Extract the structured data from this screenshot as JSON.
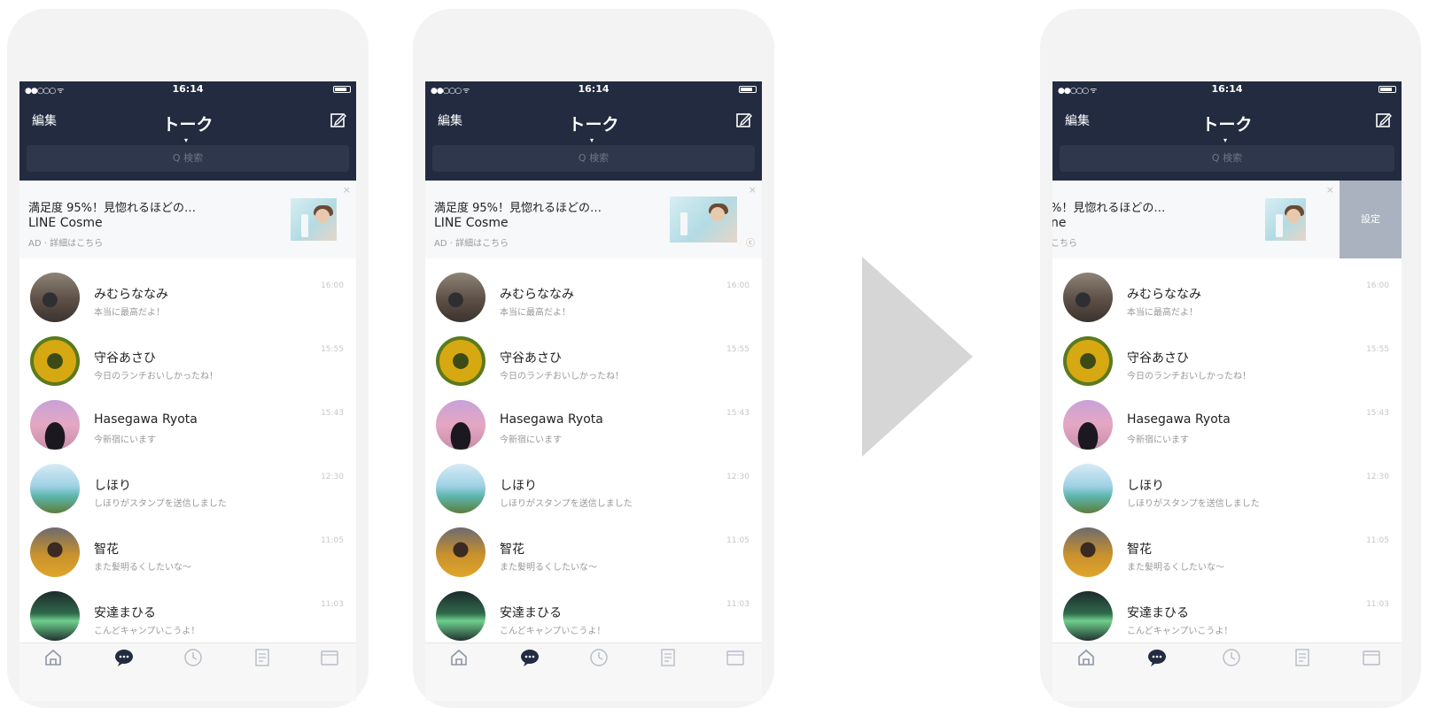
{
  "status_bar": {
    "signal": "●●○○○ ᯤ",
    "time": "16:14"
  },
  "header": {
    "edit_label": "編集",
    "title": "トーク",
    "caret": "▾"
  },
  "search": {
    "placeholder": "Q 検索"
  },
  "ad": {
    "title": "満足度 95%！見惚れるほどの…",
    "brand": "LINE Cosme",
    "sub": "AD · 詳細はこちら",
    "close": "×",
    "mark": "ⓒ",
    "swiped_title": "%！見惚れるほどの…",
    "swiped_brand": "ne",
    "swiped_sub": "こちら",
    "setting_label": "設定"
  },
  "chats": [
    {
      "name": "みむらななみ",
      "message": "本当に最高だよ！",
      "time": "16:00"
    },
    {
      "name": "守谷あさひ",
      "message": "今日のランチおいしかったね！",
      "time": "15:55"
    },
    {
      "name": "Hasegawa Ryota",
      "message": "今新宿にいます",
      "time": "15:43"
    },
    {
      "name": "しほり",
      "message": "しほりがスタンプを送信しました",
      "time": "12:30"
    },
    {
      "name": "智花",
      "message": "また髪明るくしたいな〜",
      "time": "11:05"
    },
    {
      "name": "安達まひる",
      "message": "こんどキャンプいこうよ！",
      "time": "11:03"
    }
  ],
  "tabbar": {
    "items": [
      "home-icon",
      "talk-icon",
      "timeline-icon",
      "news-icon",
      "wallet-icon"
    ]
  },
  "colors": {
    "header_bg": "#222b40",
    "ad_bg": "#f7f8fa",
    "setting_bg": "#a9b2be",
    "arrow": "#d6d6d6"
  }
}
